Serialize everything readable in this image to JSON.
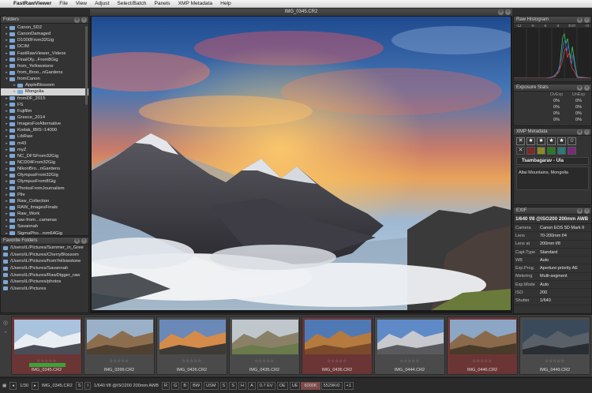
{
  "menubar": {
    "items": [
      "FastRawViewer",
      "File",
      "View",
      "Adjust",
      "Select/Batch",
      "Panels",
      "XMP Metadata",
      "Help"
    ]
  },
  "folders": {
    "title": "Folders",
    "items": [
      {
        "label": "Canon_5D2",
        "indent": 1,
        "expanded": false
      },
      {
        "label": "CanonDamaged",
        "indent": 1,
        "expanded": false
      },
      {
        "label": "D1000From32Gig",
        "indent": 1,
        "expanded": false
      },
      {
        "label": "DCIM",
        "indent": 1,
        "expanded": false
      },
      {
        "label": "FastRawViewer_Videos",
        "indent": 1,
        "expanded": false
      },
      {
        "label": "FinalOly...From8Gig",
        "indent": 1,
        "expanded": false
      },
      {
        "label": "from_Yellowstone",
        "indent": 1,
        "expanded": false
      },
      {
        "label": "from_Broo...nGardens",
        "indent": 1,
        "expanded": false
      },
      {
        "label": "fromCanon",
        "indent": 1,
        "expanded": true
      },
      {
        "label": "AppleBlossom",
        "indent": 2,
        "expanded": false
      },
      {
        "label": "Mongolia",
        "indent": 2,
        "expanded": false,
        "selected": true
      },
      {
        "label": "fromDF_2015",
        "indent": 1,
        "expanded": false
      },
      {
        "label": "FS",
        "indent": 1,
        "expanded": false
      },
      {
        "label": "Fujifilm",
        "indent": 1,
        "expanded": false
      },
      {
        "label": "Greece_2014",
        "indent": 1,
        "expanded": false
      },
      {
        "label": "ImagesForAlternative",
        "indent": 1,
        "expanded": false
      },
      {
        "label": "Kodak_IBIS~14000",
        "indent": 1,
        "expanded": false
      },
      {
        "label": "LibRaw",
        "indent": 1,
        "expanded": false
      },
      {
        "label": "m43",
        "indent": 1,
        "expanded": false
      },
      {
        "label": "myZ",
        "indent": 1,
        "expanded": false
      },
      {
        "label": "NC_DFSFrom32Gig",
        "indent": 1,
        "expanded": false
      },
      {
        "label": "NCD04From32Gig",
        "indent": 1,
        "expanded": false
      },
      {
        "label": "NikonBro...nGardens",
        "indent": 1,
        "expanded": false
      },
      {
        "label": "OlympusFrom32Gig",
        "indent": 1,
        "expanded": false
      },
      {
        "label": "OlympusFrom8Gig",
        "indent": 1,
        "expanded": false
      },
      {
        "label": "PhotosFromJournalism",
        "indent": 1,
        "expanded": false
      },
      {
        "label": "Pile",
        "indent": 1,
        "expanded": false
      },
      {
        "label": "Raw_Collection",
        "indent": 1,
        "expanded": false
      },
      {
        "label": "RAW_ImagesFinals",
        "indent": 1,
        "expanded": false
      },
      {
        "label": "Raw_Work",
        "indent": 1,
        "expanded": false
      },
      {
        "label": "raw-from...cameras",
        "indent": 1,
        "expanded": false
      },
      {
        "label": "Savannah",
        "indent": 1,
        "expanded": false
      },
      {
        "label": "SigmaPho...rom64Gig",
        "indent": 1,
        "expanded": false
      }
    ]
  },
  "favorites": {
    "title": "Favorite Folders",
    "items": [
      "/Users/iL/Pictures/Summer_in_Gree",
      "/Users/iL/Pictures/CherryBlossom",
      "/Users/iL/Pictures/fromYellowstone",
      "/Users/iL/Pictures/Savannah",
      "/Users/iL/Pictures/RawDigger_raw",
      "/Users/iL/Pictures/photos",
      "/Users/iL/Pictures"
    ]
  },
  "viewer": {
    "title": "IMG_0345.CR2"
  },
  "histogram": {
    "title": "Raw Histogram",
    "scale": [
      "-12",
      "-9",
      "-6",
      "-3",
      "EV0",
      "+3"
    ]
  },
  "exposure": {
    "title": "Exposure Stats",
    "headers": [
      "",
      "OvExp",
      "UnExp"
    ],
    "rows": [
      [
        "",
        "0%",
        "0%"
      ],
      [
        "",
        "0%",
        "0%"
      ],
      [
        "",
        "0%",
        "0%"
      ],
      [
        "",
        "0%",
        "0%"
      ]
    ]
  },
  "xmp": {
    "title": "XMP Metadata",
    "title_field": "Tsambagarav - Ula",
    "description": "Altai Mountains, Mongolia",
    "colors": [
      "#7a2a2a",
      "#8a8a2a",
      "#2a7a2a",
      "#2a7a7a",
      "#7a2a7a"
    ]
  },
  "exif": {
    "title": "EXIF",
    "summary": "1/640 f/8 @ISO200 200mm AWB",
    "rows": [
      [
        "Camera",
        "Canon EOS 5D Mark II"
      ],
      [
        "Lens",
        "70-200mm f/4"
      ],
      [
        "Lens at",
        "200mm f/8"
      ],
      [
        "Capt.Type",
        "Standard"
      ],
      [
        "WB",
        "Auto"
      ],
      [
        "Exp.Prog.",
        "Aperture-priority AE"
      ],
      [
        "Metering",
        "Multi-segment"
      ],
      [
        "Exp.Mode",
        "Auto"
      ],
      [
        "ISO",
        "200"
      ],
      [
        "Shutter",
        "1/640"
      ]
    ]
  },
  "filmstrip": {
    "thumbs": [
      {
        "name": "IMG_0345.CR2",
        "red": true,
        "selected": true,
        "hue": "snow"
      },
      {
        "name": "IMG_0399.CR2",
        "red": false,
        "hue": "brown"
      },
      {
        "name": "IMG_0426.CR2",
        "red": false,
        "hue": "sunset"
      },
      {
        "name": "IMG_0435.CR2",
        "red": false,
        "hue": "plain"
      },
      {
        "name": "IMG_0436.CR2",
        "red": true,
        "hue": "dune"
      },
      {
        "name": "IMG_0444.CR2",
        "red": false,
        "hue": "rock"
      },
      {
        "name": "IMG_0446.CR2",
        "red": true,
        "hue": "valley"
      },
      {
        "name": "IMG_0449.CR2",
        "red": false,
        "hue": "dark"
      }
    ],
    "stars": "☆☆☆☆☆"
  },
  "status": {
    "left_num": "1/30",
    "file": "IMG_0345.CR2",
    "exp": "1/640 f/8 @ISO200 200mm AWB",
    "channels": [
      "R",
      "G",
      "B",
      "BW"
    ],
    "usm": "USM",
    "ev": "0.7 EV",
    "oe": "OE",
    "ue": "UE",
    "temp": "6000K",
    "coords": "5529K/0",
    "plus": "+1",
    "misc": [
      "S",
      "I",
      "S",
      "S",
      "H",
      "A"
    ]
  }
}
